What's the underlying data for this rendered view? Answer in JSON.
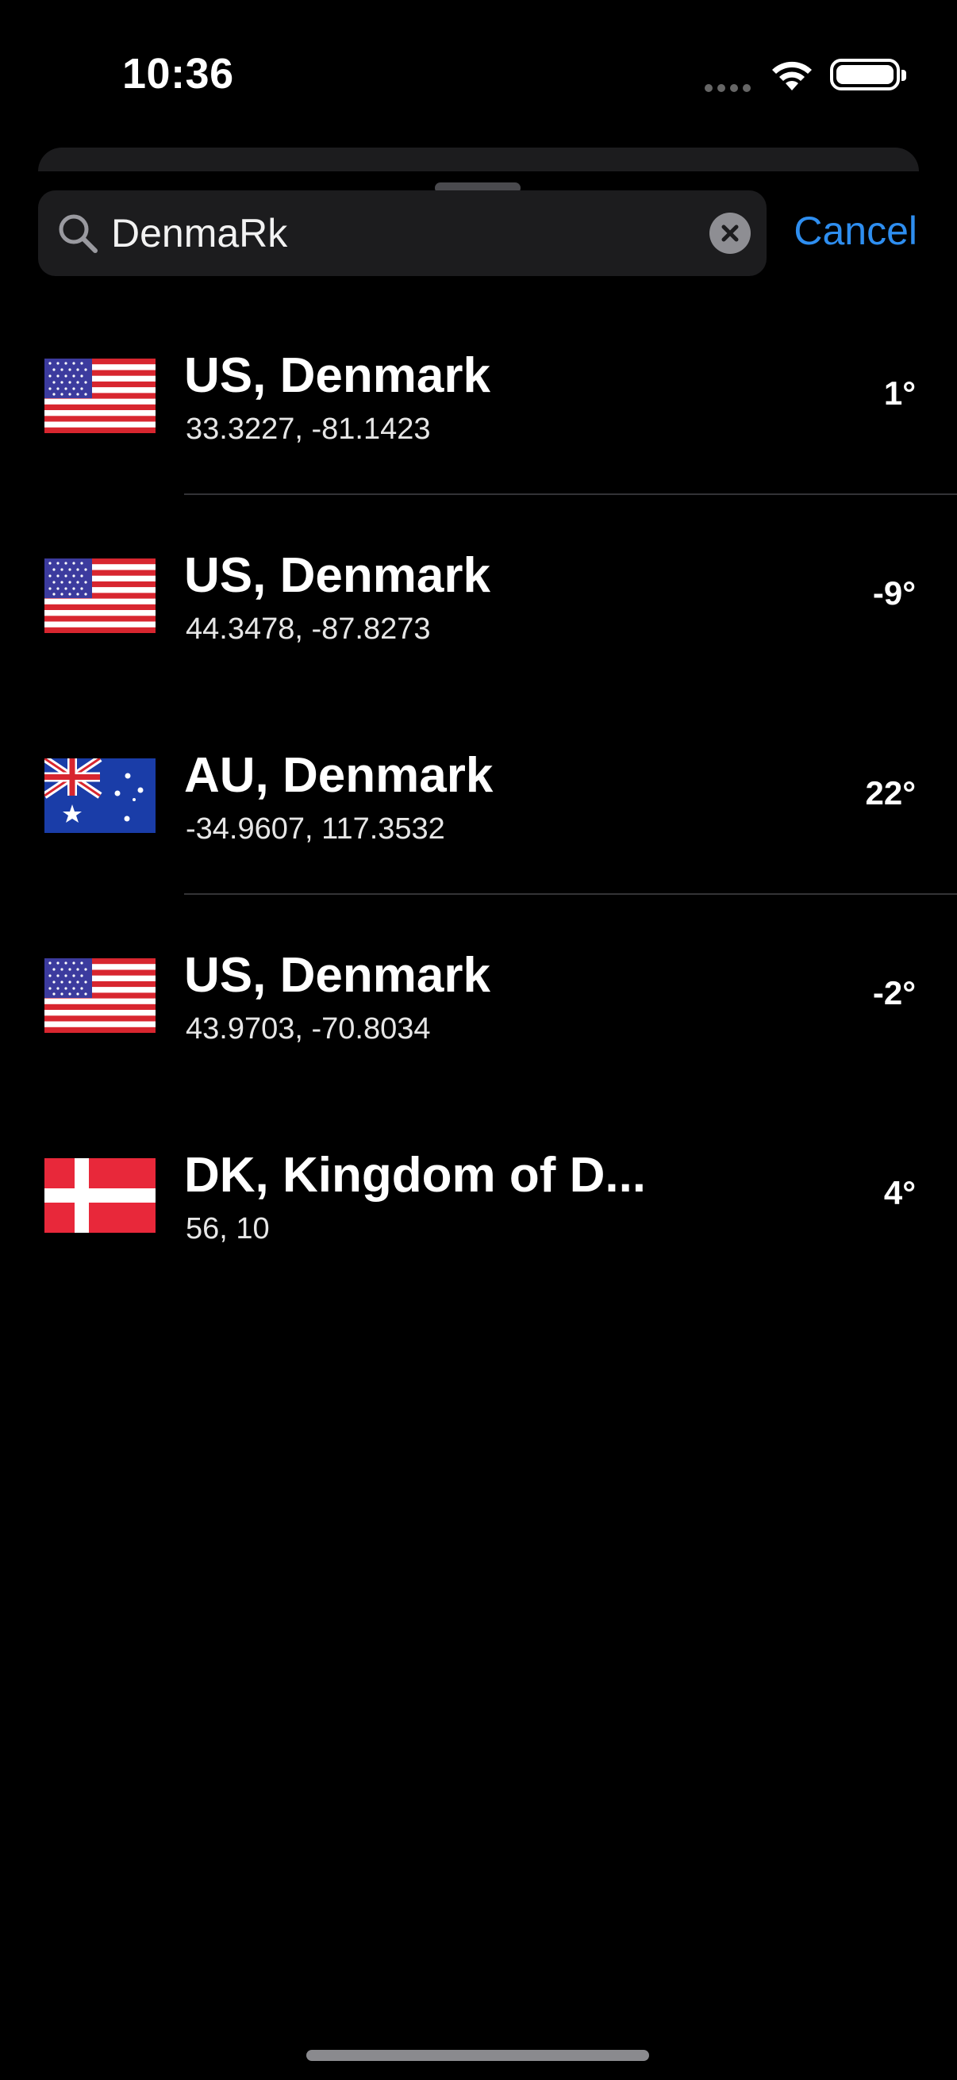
{
  "status_bar": {
    "time": "10:36"
  },
  "search": {
    "value": "DenmaRk",
    "cancel_label": "Cancel"
  },
  "results": [
    {
      "flag": "us-flag",
      "name": "US, Denmark",
      "coords": "33.3227, -81.1423",
      "temp": "1°"
    },
    {
      "flag": "us-flag",
      "name": "US, Denmark",
      "coords": "44.3478, -87.8273",
      "temp": "-9°"
    },
    {
      "flag": "au-flag",
      "name": "AU, Denmark",
      "coords": "-34.9607, 117.3532",
      "temp": "22°"
    },
    {
      "flag": "us-flag",
      "name": "US, Denmark",
      "coords": "43.9703, -70.8034",
      "temp": "-2°"
    },
    {
      "flag": "dk-flag",
      "name": "DK, Kingdom of D...",
      "coords": "56, 10",
      "temp": "4°"
    }
  ],
  "colors": {
    "background": "#000000",
    "field": "#1c1c1e",
    "accent": "#2e8ef0"
  }
}
